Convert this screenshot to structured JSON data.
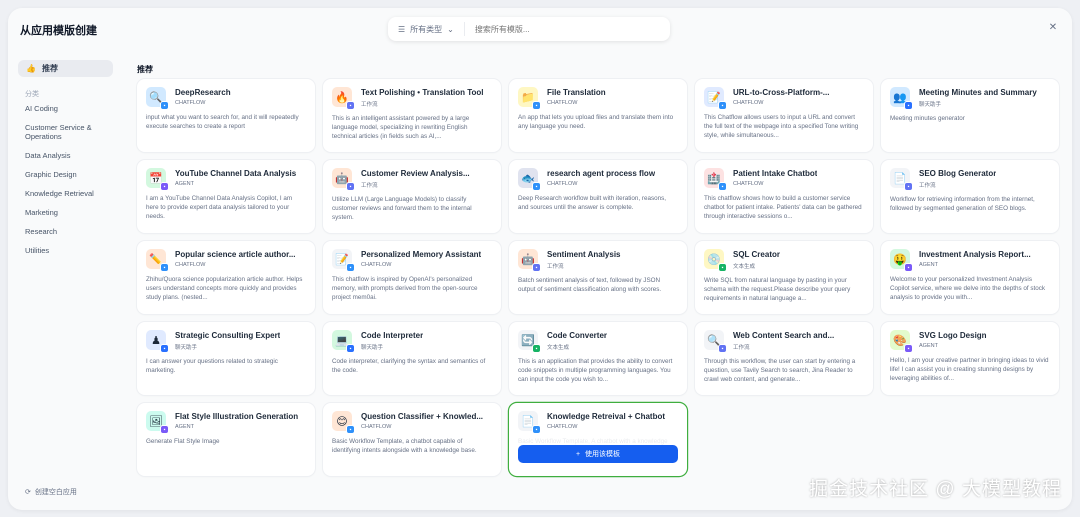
{
  "header": {
    "title": "从应用模版创建",
    "filter_label": "所有类型",
    "search_placeholder": "搜索所有模版...",
    "close_icon": "close-icon"
  },
  "sidebar": {
    "recommended": "推荐",
    "category_label": "分类",
    "items": [
      "AI Coding",
      "Customer Service & Operations",
      "Data Analysis",
      "Graphic Design",
      "Knowledge Retrieval",
      "Marketing",
      "Research",
      "Utilities"
    ],
    "create_blank": "创建空白应用"
  },
  "section_title": "推荐",
  "use_template_label": "使用该模板",
  "watermark": "掘金技术社区 @ 大模型教程",
  "type_colors": {
    "CHATFLOW": "#2e90fa",
    "工作流": "#6172f3",
    "聊天助手": "#2970ff",
    "AGENT": "#7a5af8",
    "文本生成": "#16b364"
  },
  "templates": [
    {
      "name": "DeepResearch",
      "type": "CHATFLOW",
      "desc": "input what you want to search for, and it will repeatedly execute searches to create a report",
      "icon": "🔍",
      "bg": "#d1e9ff"
    },
    {
      "name": "Text Polishing • Translation Tool",
      "type": "工作流",
      "desc": "This is an intelligent assistant powered by a large language model, specializing in rewriting English technical articles (in fields such as AI,...",
      "icon": "🔥",
      "bg": "#ffe6d5"
    },
    {
      "name": "File Translation",
      "type": "CHATFLOW",
      "desc": "An app that lets you upload files and translate them into any language you need.",
      "icon": "📁",
      "bg": "#fef7c3"
    },
    {
      "name": "URL-to-Cross-Platform-...",
      "type": "CHATFLOW",
      "desc": "This Chatflow allows users to input a URL and convert the full text of the webpage into a specified Tone writing style, while simultaneous...",
      "icon": "📝",
      "bg": "#e0eaff"
    },
    {
      "name": "Meeting Minutes and Summary",
      "type": "聊天助手",
      "desc": "Meeting minutes generator",
      "icon": "👥",
      "bg": "#d1e9ff"
    },
    {
      "name": "YouTube Channel Data Analysis",
      "type": "AGENT",
      "desc": "I am a YouTube Channel Data Analysis Copilot, I am here to provide expert data analysis tailored to your needs.",
      "icon": "📅",
      "bg": "#d3f8df"
    },
    {
      "name": "Customer Review Analysis...",
      "type": "工作流",
      "desc": "Utilize LLM (Large Language Models) to classify customer reviews and forward them to the internal system.",
      "icon": "🤖",
      "bg": "#ffe6d5"
    },
    {
      "name": "research agent process flow",
      "type": "CHATFLOW",
      "desc": "Deep Research workflow built with iteration, reasons, and sources until the answer is complete.",
      "icon": "🐟",
      "bg": "#e0e3ef"
    },
    {
      "name": "Patient Intake Chatbot",
      "type": "CHATFLOW",
      "desc": "This chatflow shows how to build a customer service chatbot for patient intake. Patients' data can be gathered through interactive sessions o...",
      "icon": "🏥",
      "bg": "#fde2e2"
    },
    {
      "name": "SEO Blog Generator",
      "type": "工作流",
      "desc": "Workflow for retrieving information from the internet, followed by segmented generation of SEO blogs.",
      "icon": "📄",
      "bg": "#f2f4f7"
    },
    {
      "name": "Popular science article author...",
      "type": "CHATFLOW",
      "desc": "Zhihu/Quora science popularization article author. Helps users understand concepts more quickly and provides study plans. (nested...",
      "icon": "✏️",
      "bg": "#ffe6d5"
    },
    {
      "name": "Personalized Memory Assistant",
      "type": "CHATFLOW",
      "desc": "This chatflow is inspired by OpenAI's personalized memory, with prompts derived from the open-source project mem0ai.",
      "icon": "📝",
      "bg": "#f2f4f7"
    },
    {
      "name": "Sentiment Analysis",
      "type": "工作流",
      "desc": "Batch sentiment analysis of text, followed by JSON output of sentiment classification along with scores.",
      "icon": "🤖",
      "bg": "#ffe6d5"
    },
    {
      "name": "SQL Creator",
      "type": "文本生成",
      "desc": "Write SQL from natural language by pasting in your schema with the request.Please describe your query requirements in natural language a...",
      "icon": "💿",
      "bg": "#fef7c3"
    },
    {
      "name": "Investment Analysis Report...",
      "type": "AGENT",
      "desc": "Welcome to your personalized Investment Analysis Copilot service, where we delve into the depths of stock analysis to provide you with...",
      "icon": "🤑",
      "bg": "#d3f8df"
    },
    {
      "name": "Strategic Consulting Expert",
      "type": "聊天助手",
      "desc": "I can answer your questions related to strategic marketing.",
      "icon": "♟",
      "bg": "#e0eaff"
    },
    {
      "name": "Code Interpreter",
      "type": "聊天助手",
      "desc": "Code interpreter, clarifying the syntax and semantics of the code.",
      "icon": "💻",
      "bg": "#d3f8df"
    },
    {
      "name": "Code Converter",
      "type": "文本生成",
      "desc": "This is an application that provides the ability to convert code snippets in multiple programming languages. You can input the code you wish to...",
      "icon": "🔄",
      "bg": "#f2f4f7"
    },
    {
      "name": "Web Content Search and...",
      "type": "工作流",
      "desc": "Through this workflow, the user can start by entering a question, use Tavily Search to search, Jina Reader to crawl web content, and generate...",
      "icon": "🔍",
      "bg": "#f2f4f7"
    },
    {
      "name": "SVG Logo Design",
      "type": "AGENT",
      "desc": "Hello, I am your creative partner in bringing ideas to vivid life! I can assist you in creating stunning designs by leveraging abilities of...",
      "icon": "🎨",
      "bg": "#e3fbcc"
    },
    {
      "name": "Flat Style Illustration Generation",
      "type": "AGENT",
      "desc": "Generate Flat Style Image",
      "icon": "🖼",
      "bg": "#ccfbef"
    },
    {
      "name": "Question Classifier + Knowled...",
      "type": "CHATFLOW",
      "desc": "Basic Workflow Template, a chatbot capable of identifying intents alongside with a knowledge base.",
      "icon": "😊",
      "bg": "#ffe6d5"
    },
    {
      "name": "Knowledge Retreival + Chatbot",
      "type": "CHATFLOW",
      "desc": "Basic Workflow Template, A chatbot with a knowledge base.",
      "icon": "📄",
      "bg": "#f2f4f7",
      "hovered": true
    }
  ]
}
